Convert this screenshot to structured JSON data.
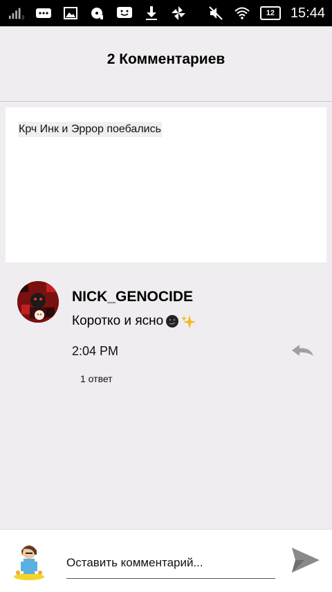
{
  "status_bar": {
    "signal_sub": "2",
    "battery": "12",
    "time": "15:44"
  },
  "header": {
    "title": "2 Комментариев"
  },
  "post": {
    "text": "Крч Инк и Эррор поебались"
  },
  "comment": {
    "username": "NICK_GENOCIDE",
    "text": "Коротко и ясно",
    "time": "2:04 PM",
    "replies": "1 ответ"
  },
  "composer": {
    "placeholder": "Оставить комментарий..."
  },
  "colors": {
    "background": "#efedef",
    "card": "#ffffff",
    "reply_icon": "#9e9e9e",
    "send_icon": "#8a8a8a"
  }
}
